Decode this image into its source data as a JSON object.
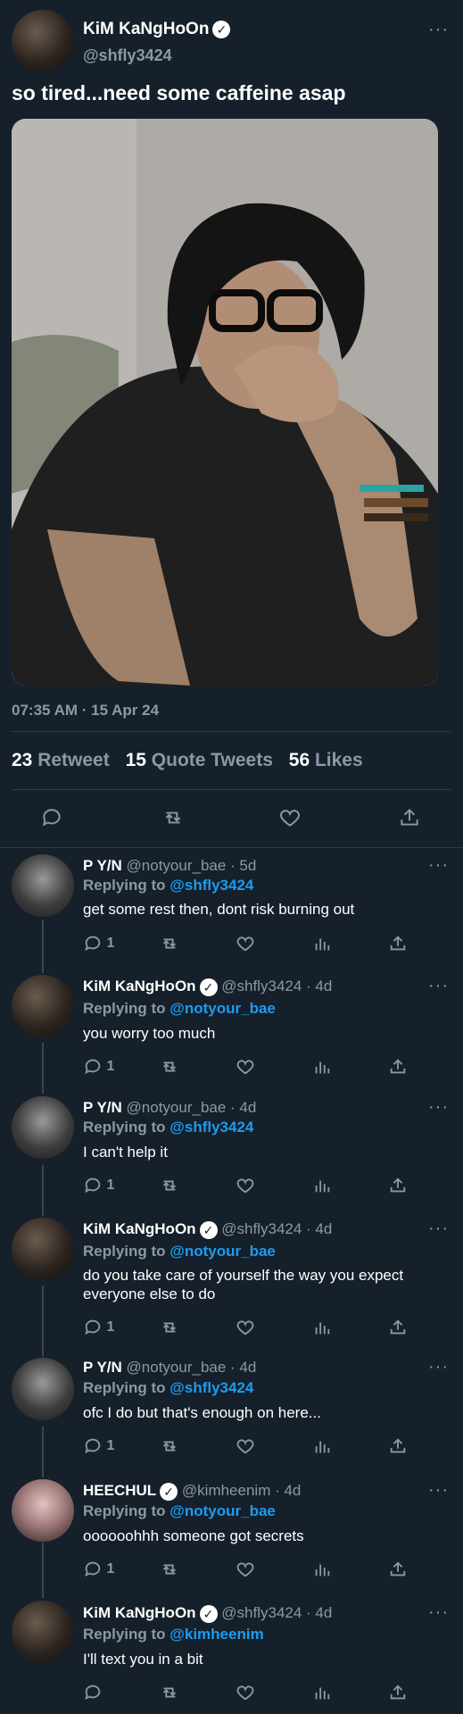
{
  "tweet": {
    "author_name": "KiM KaNgHoOn",
    "author_handle": "@shfly3424",
    "text": "so tired...need some caffeine asap",
    "timestamp": "07:35 AM · 15 Apr 24",
    "retweets_count": "23",
    "retweets_label": "Retweet",
    "quotes_count": "15",
    "quotes_label": "Quote Tweets",
    "likes_count": "56",
    "likes_label": "Likes"
  },
  "replies": [
    {
      "name": "P Y/N",
      "handle": "@notyour_bae · 5d",
      "replying_label": "Replying to",
      "replying_to": "@shfly3424",
      "text": "get some rest then, dont risk burning out",
      "reply_count": "1"
    },
    {
      "name": "KiM KaNgHoOn",
      "handle": "@shfly3424 · 4d",
      "replying_label": "Replying to",
      "replying_to": "@notyour_bae",
      "text": "you worry too much",
      "reply_count": "1"
    },
    {
      "name": "P Y/N",
      "handle": "@notyour_bae · 4d",
      "replying_label": "Replying to",
      "replying_to": "@shfly3424",
      "text": "I can't help it",
      "reply_count": "1"
    },
    {
      "name": "KiM KaNgHoOn",
      "handle": "@shfly3424 · 4d",
      "replying_label": "Replying to",
      "replying_to": "@notyour_bae",
      "text": "do you take care of yourself the way you expect everyone else to do",
      "reply_count": "1"
    },
    {
      "name": "P Y/N",
      "handle": "@notyour_bae · 4d",
      "replying_label": "Replying to",
      "replying_to": "@shfly3424",
      "text": "ofc I do but that's enough on here...",
      "reply_count": "1"
    },
    {
      "name": "HEECHUL",
      "handle": "@kimheenim · 4d",
      "replying_label": "Replying to",
      "replying_to": "@notyour_bae",
      "text": "oooooohhh someone got secrets",
      "reply_count": "1"
    },
    {
      "name": "KiM KaNgHoOn",
      "handle": "@shfly3424 · 4d",
      "replying_label": "Replying to",
      "replying_to": "@kimheenim",
      "text": "I'll text you in a bit",
      "reply_count": ""
    }
  ],
  "colors": {
    "background": "#15202b",
    "accent": "#1d9bf0",
    "muted": "#8b98a5"
  }
}
